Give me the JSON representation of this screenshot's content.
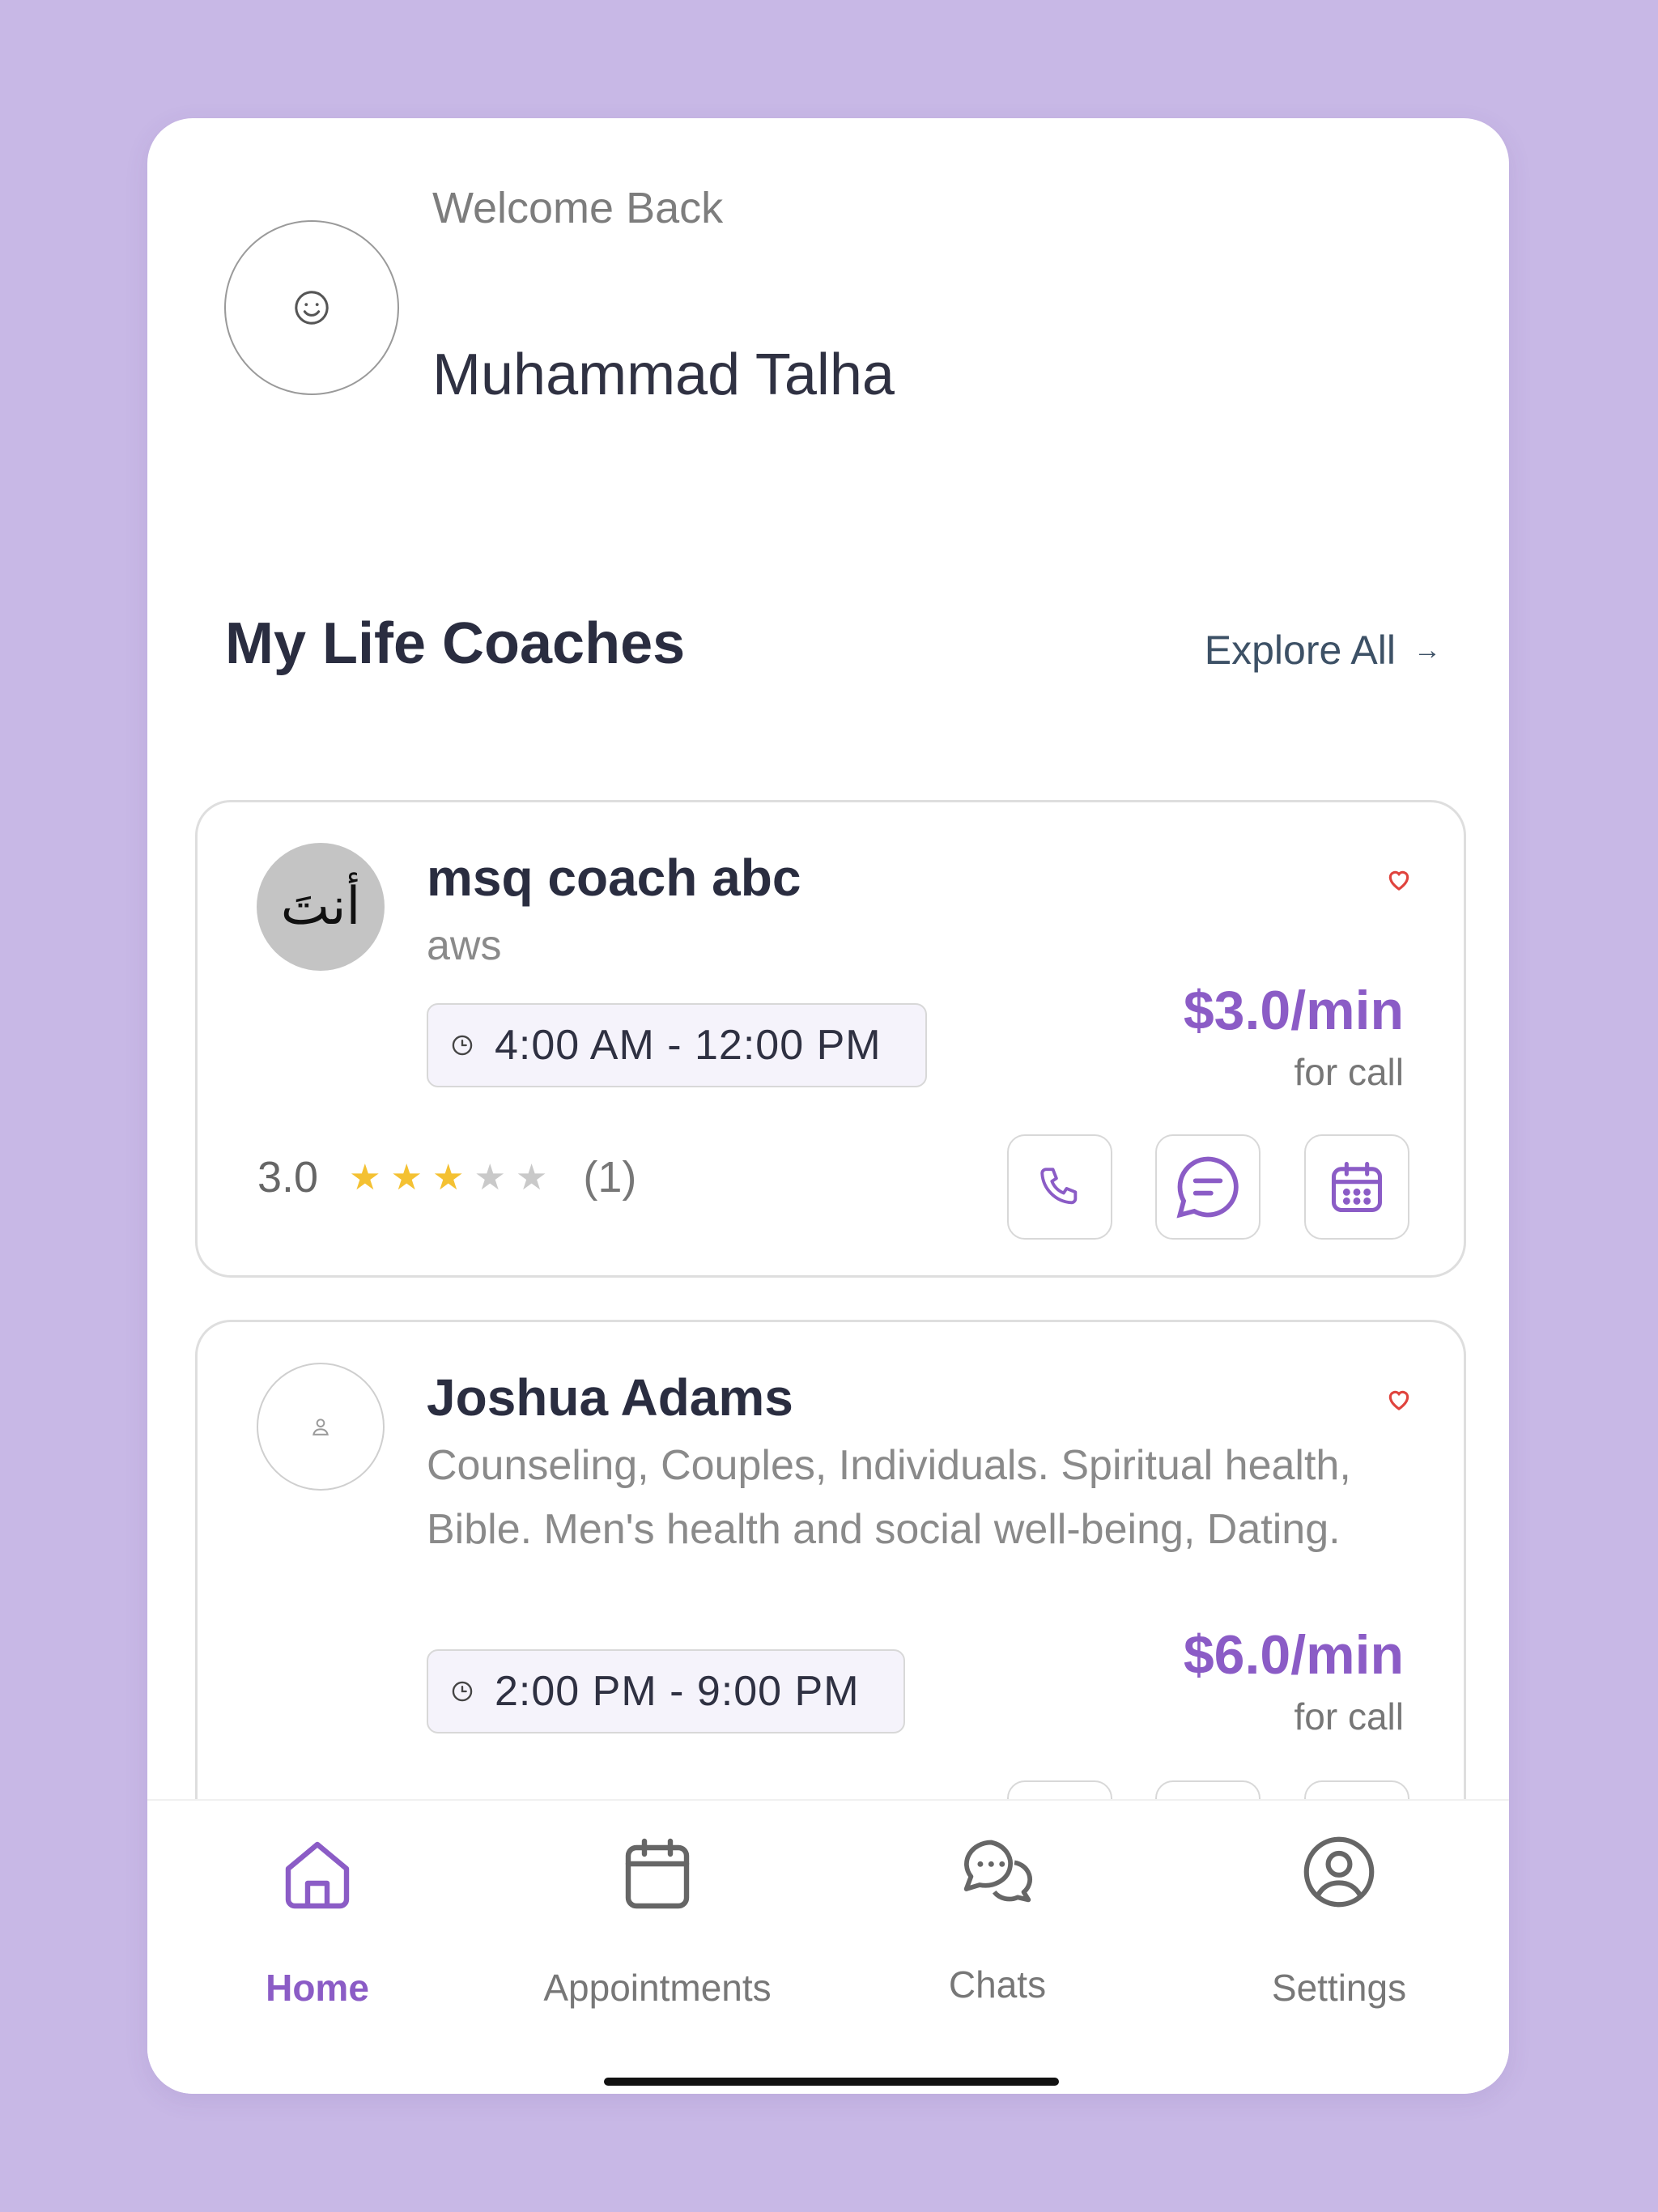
{
  "header": {
    "welcome": "Welcome Back",
    "user_name": "Muhammad Talha"
  },
  "section": {
    "title": "My Life Coaches",
    "explore_label": "Explore All"
  },
  "coaches": [
    {
      "name": "msq coach abc",
      "description": "aws",
      "hours": "4:00 AM - 12:00 PM",
      "price": "$3.0/min",
      "price_note": "for call",
      "rating": "3.0",
      "rating_stars": 3,
      "rating_count": "(1)",
      "avatar_text": "أنتَ"
    },
    {
      "name": "Joshua Adams",
      "description": "Counseling, Couples, Individuals. Spiritual health, Bible. Men's health and social well-being, Dating.",
      "hours": "2:00 PM - 9:00 PM",
      "price": "$6.0/min",
      "price_note": "for call"
    }
  ],
  "nav": {
    "items": [
      {
        "label": "Home",
        "icon": "home-icon",
        "active": true
      },
      {
        "label": "Appointments",
        "icon": "calendar-icon",
        "active": false
      },
      {
        "label": "Chats",
        "icon": "chats-icon",
        "active": false
      },
      {
        "label": "Settings",
        "icon": "user-circle-icon",
        "active": false
      }
    ]
  },
  "colors": {
    "background": "#c8b8e6",
    "accent": "#8b5cc6",
    "star": "#f4c132",
    "heart": "#e0443e"
  }
}
